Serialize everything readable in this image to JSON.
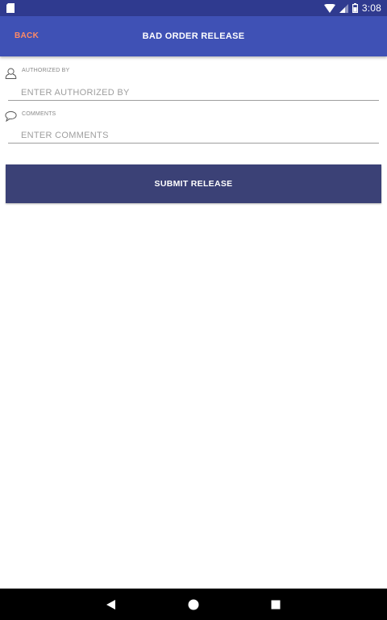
{
  "status_bar": {
    "time": "3:08",
    "icons": [
      "sd-card-icon",
      "wifi-icon",
      "cell-signal-icon",
      "battery-icon"
    ]
  },
  "app_bar": {
    "back_label": "BACK",
    "title": "BAD ORDER RELEASE"
  },
  "form": {
    "authorized_by": {
      "label": "AUTHORIZED BY",
      "placeholder": "ENTER AUTHORIZED BY",
      "value": "",
      "icon": "person-icon"
    },
    "comments": {
      "label": "COMMENTS",
      "placeholder": "ENTER COMMENTS",
      "value": "",
      "icon": "speech-bubble-icon"
    },
    "submit_label": "SUBMIT RELEASE"
  },
  "nav_bar": {
    "buttons": [
      "back-triangle-icon",
      "home-circle-icon",
      "recents-square-icon"
    ]
  },
  "colors": {
    "status_bar": "#2f3a8f",
    "app_bar": "#3f51b5",
    "back_text": "#ff8a65",
    "submit_button": "#3b4176",
    "nav_bar": "#000000"
  }
}
